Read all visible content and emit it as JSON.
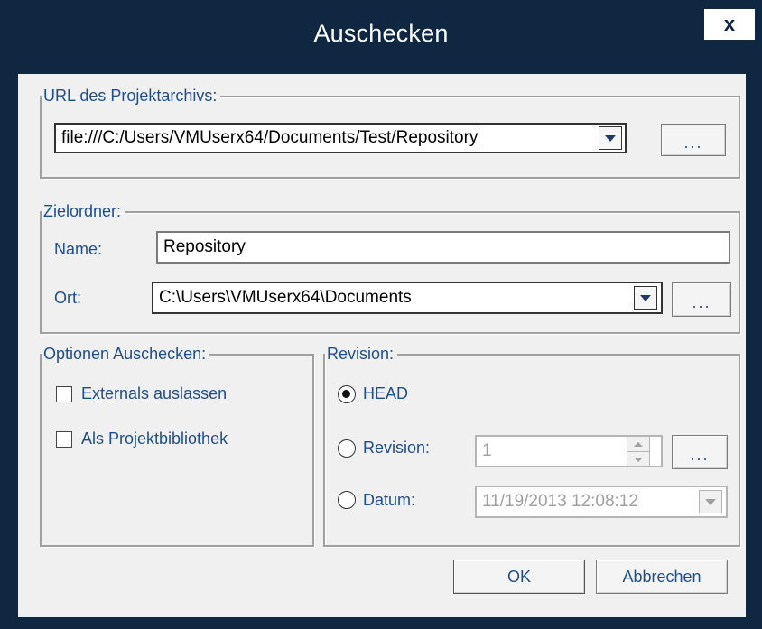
{
  "window": {
    "title": "Auschecken",
    "close_label": "x"
  },
  "url_group": {
    "legend": "URL des Projektarchivs:",
    "url_value": "file:///C:/Users/VMUserx64/Documents/Test/Repository",
    "browse_label": "..."
  },
  "target_group": {
    "legend": "Zielordner:",
    "name_label": "Name:",
    "name_value": "Repository",
    "location_label": "Ort:",
    "location_value": "C:\\Users\\VMUserx64\\Documents",
    "browse_label": "..."
  },
  "options_group": {
    "legend": "Optionen Auschecken:",
    "items": [
      {
        "label": "Externals auslassen",
        "checked": false
      },
      {
        "label": "Als Projektbibliothek",
        "checked": false
      }
    ]
  },
  "revision_group": {
    "legend": "Revision:",
    "head_label": "HEAD",
    "revision_label": "Revision:",
    "revision_value": "1",
    "revision_browse_label": "...",
    "date_label": "Datum:",
    "date_value": "11/19/2013 12:08:12",
    "selected": "HEAD"
  },
  "buttons": {
    "ok": "OK",
    "cancel": "Abbrechen"
  },
  "icons": {
    "dropdown": "chevron-down-icon",
    "spin": "spinner-icon"
  },
  "colors": {
    "title_bar": "#0f2740",
    "label_blue": "#1f4e8c",
    "dialog_bg": "#f0f0f0"
  }
}
